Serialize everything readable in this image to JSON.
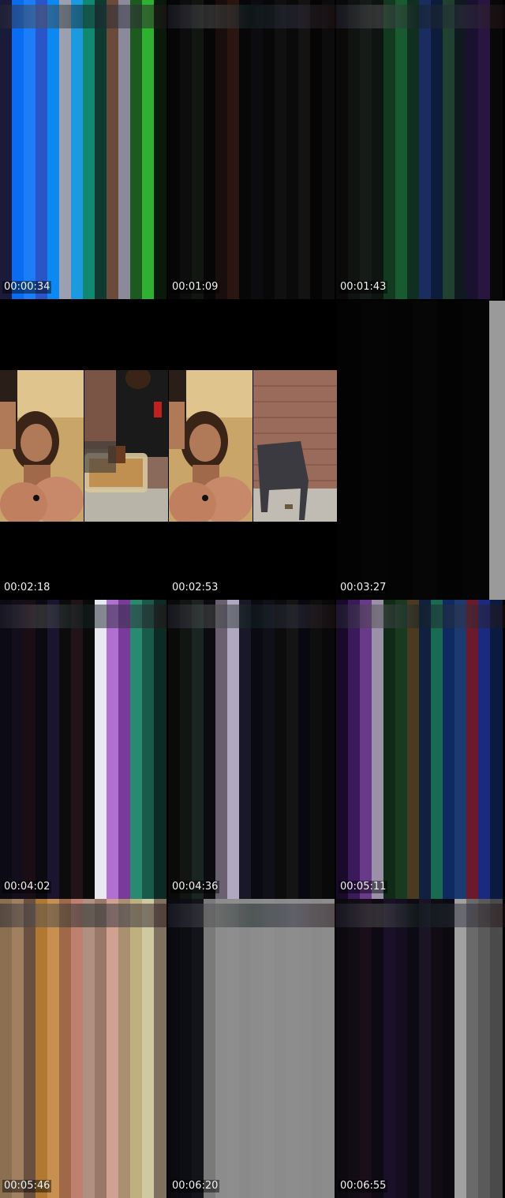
{
  "title": "",
  "thumbnails": [
    {
      "timestamp": "00:00:34",
      "type": "glitch",
      "strips": [
        "#1a1a3a",
        "#0a6cf0",
        "#1b7ef8",
        "#2a55c8",
        "#0c88f2",
        "#9aa0b0",
        "#1c9ae0",
        "#118870",
        "#0e3a30",
        "#6a4a3a",
        "#8a8a9a",
        "#1d5a20",
        "#30b030",
        "#0a1a0a"
      ]
    },
    {
      "timestamp": "00:01:09",
      "type": "glitch",
      "strips": [
        "#060606",
        "#0d0d0d",
        "#111611",
        "#060606",
        "#1a0d0d",
        "#2a1510",
        "#070707",
        "#0c0c10",
        "#080808",
        "#101010",
        "#0a0a0a",
        "#151212",
        "#050505",
        "#0c0c0c"
      ]
    },
    {
      "timestamp": "00:01:43",
      "type": "glitch",
      "strips": [
        "#0a0a0a",
        "#101410",
        "#161a18",
        "#0e1410",
        "#123a20",
        "#1a5a30",
        "#0f3020",
        "#1b2d60",
        "#0c1c3a",
        "#204030",
        "#101820",
        "#1a1030",
        "#2a1540",
        "#080808"
      ]
    },
    {
      "timestamp": "00:02:18",
      "type": "photos",
      "photos": [
        "woman-selfie",
        "man-holding-container",
        "woman-selfie",
        "brick-wall-chair"
      ]
    },
    {
      "timestamp": "00:02:53",
      "type": "photos-continued"
    },
    {
      "timestamp": "00:03:27",
      "type": "dark",
      "strips": [
        "#030303",
        "#050505",
        "#040404",
        "#060606",
        "#030303",
        "#050505",
        "#9a9a9a"
      ]
    },
    {
      "timestamp": "00:04:02",
      "type": "glitch",
      "strips": [
        "#0c0a14",
        "#140e1c",
        "#1a0e14",
        "#0a0a10",
        "#1a1430",
        "#0c0c0c",
        "#201418",
        "#0a0a0a",
        "#e8e8f0",
        "#b070d0",
        "#7a3a9a",
        "#2a8a70",
        "#1a5a4a",
        "#0e2a24"
      ]
    },
    {
      "timestamp": "00:04:36",
      "type": "glitch",
      "strips": [
        "#0a0a0a",
        "#121612",
        "#1a2420",
        "#0c0c10",
        "#6a6070",
        "#b0a8c0",
        "#181828",
        "#0a0a12",
        "#101018",
        "#0c0c0c",
        "#141414",
        "#080810",
        "#0e0e0e",
        "#090909"
      ]
    },
    {
      "timestamp": "00:05:11",
      "type": "glitch",
      "strips": [
        "#1a0a2a",
        "#3a1a5a",
        "#6a3a8a",
        "#9a90a8",
        "#102a18",
        "#1a3a20",
        "#4a3a20",
        "#102040",
        "#1a6a50",
        "#0e2a60",
        "#1a3a70",
        "#6a1a2a",
        "#1a2a80",
        "#0a1a40"
      ]
    },
    {
      "timestamp": "00:05:46",
      "type": "glitch",
      "strips": [
        "#8a7050",
        "#a08060",
        "#6a5040",
        "#b07830",
        "#c89050",
        "#a06848",
        "#c08070",
        "#b09080",
        "#9a7868",
        "#d0a090",
        "#a89070",
        "#c0b080",
        "#d0c8a0",
        "#807060"
      ]
    },
    {
      "timestamp": "00:06:20",
      "type": "glitch",
      "strips": [
        "#0a0a10",
        "#0c0e14",
        "#12141a",
        "#7a7a7a",
        "#8c8c8c",
        "#8e8e8e",
        "#8a8a8a",
        "#8c8c8c",
        "#8e8e8e",
        "#8b8b8b",
        "#8d8d8d",
        "#8c8c8c",
        "#8a8a8a",
        "#8c8c8c"
      ]
    },
    {
      "timestamp": "00:06:55",
      "type": "glitch",
      "strips": [
        "#0c0a0e",
        "#120c14",
        "#1a0e18",
        "#0e0a14",
        "#1a1028",
        "#140e20",
        "#0c0a12",
        "#1a1424",
        "#100c14",
        "#0c0a10",
        "#a0a0a0",
        "#6a6a6a",
        "#5a5a5a",
        "#4a4a4a"
      ]
    }
  ]
}
